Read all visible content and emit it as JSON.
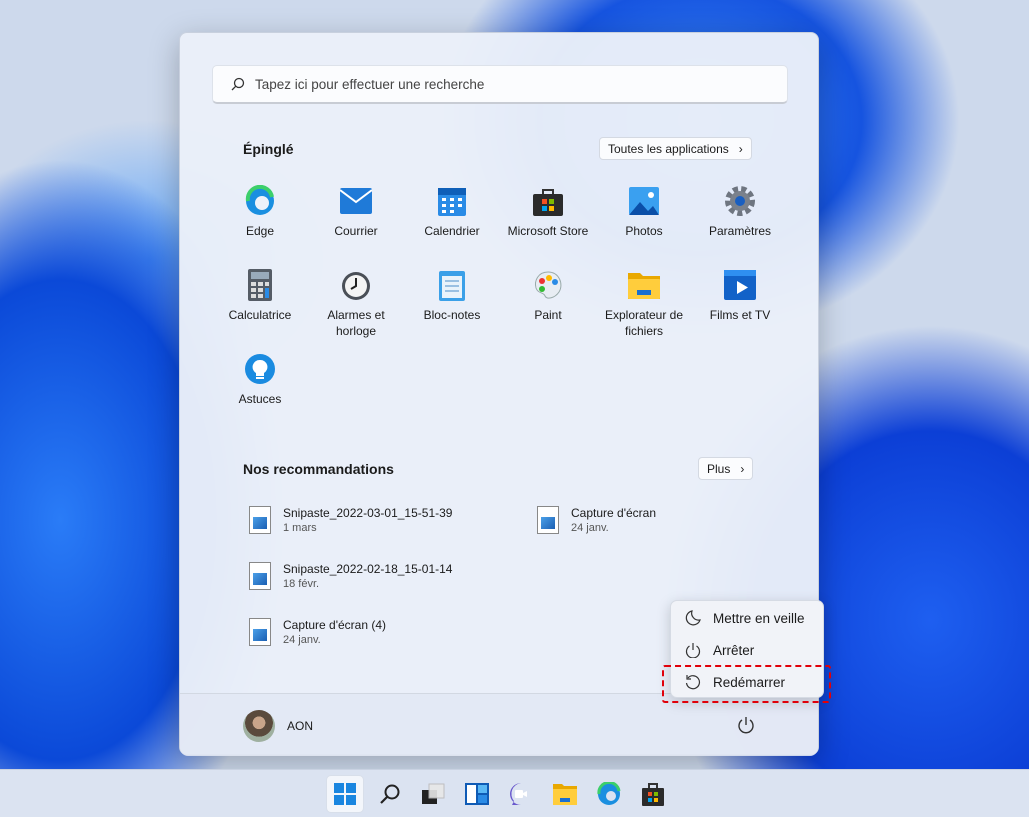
{
  "search": {
    "placeholder": "Tapez ici pour effectuer une recherche"
  },
  "pinned": {
    "title": "Épinglé",
    "all_apps": "Toutes les applications",
    "apps": [
      {
        "label": "Edge"
      },
      {
        "label": "Courrier"
      },
      {
        "label": "Calendrier"
      },
      {
        "label": "Microsoft Store"
      },
      {
        "label": "Photos"
      },
      {
        "label": "Paramètres"
      },
      {
        "label": "Calculatrice"
      },
      {
        "label": "Alarmes et horloge"
      },
      {
        "label": "Bloc-notes"
      },
      {
        "label": "Paint"
      },
      {
        "label": "Explorateur de fichiers"
      },
      {
        "label": "Films et TV"
      },
      {
        "label": "Astuces"
      }
    ]
  },
  "recommended": {
    "title": "Nos recommandations",
    "more": "Plus",
    "items": [
      {
        "name": "Snipaste_2022-03-01_15-51-39",
        "date": "1 mars"
      },
      {
        "name": "Capture d'écran",
        "date": "24 janv."
      },
      {
        "name": "Snipaste_2022-02-18_15-01-14",
        "date": "18 févr."
      },
      {
        "name": "Capture d'écran (4)",
        "date": "24 janv."
      }
    ]
  },
  "user": {
    "name": "AON"
  },
  "power_menu": {
    "items": [
      {
        "label": "Mettre en veille"
      },
      {
        "label": "Arrêter"
      },
      {
        "label": "Redémarrer"
      }
    ]
  },
  "colors": {
    "highlight": "#e0000a",
    "accent": "#0067c0"
  }
}
